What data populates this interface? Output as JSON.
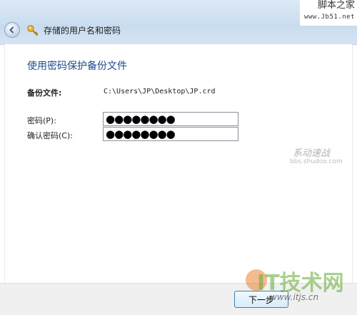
{
  "window": {
    "title": "存储的用户名和密码"
  },
  "dialog": {
    "heading": "使用密码保护备份文件",
    "backup_file_label": "备份文件:",
    "backup_file_value": "C:\\Users\\JP\\Desktop\\JP.crd",
    "password_label": "密码(P):",
    "password_value": "●●●●●●●●",
    "confirm_password_label": "确认密码(C):",
    "confirm_password_value": "●●●●●●●●"
  },
  "footer": {
    "next_label": "下一步"
  },
  "watermarks": {
    "top_line1": "脚本之家",
    "top_line2": "www.Jb51.net",
    "mid_line1": "系动速战",
    "mid_line2": "bbs.shudoo.com",
    "bottom_logo": "IT技术网",
    "bottom_url": "www.itjs.cn"
  },
  "colors": {
    "heading": "#1c4a8c",
    "titlebar": "#c9dcef",
    "footer": "#f0f0f0"
  },
  "icons": {
    "back": "back-arrow-icon",
    "key": "key-icon"
  }
}
